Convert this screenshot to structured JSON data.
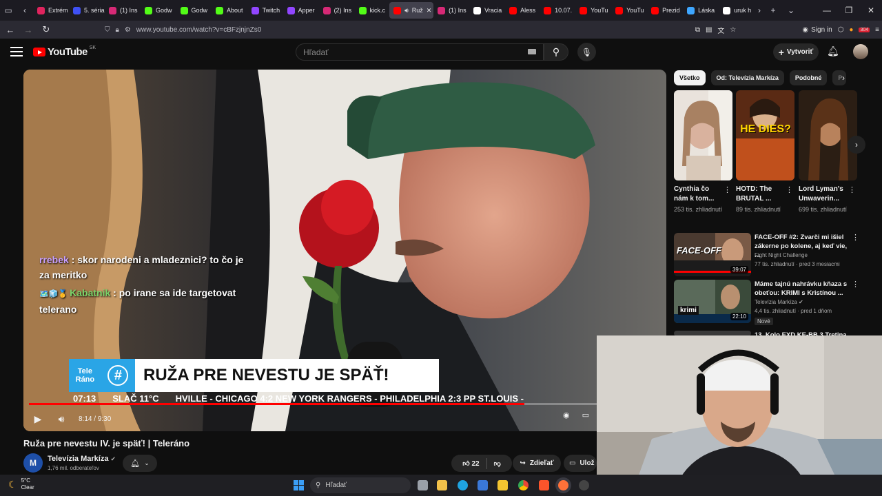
{
  "browser": {
    "tabs": [
      {
        "label": "Extrém",
        "color": "#e0245e"
      },
      {
        "label": "5. séria",
        "color": "#3f51f5"
      },
      {
        "label": "(1) Ins",
        "color": "#d62976"
      },
      {
        "label": "Godw",
        "color": "#53fc18"
      },
      {
        "label": "Godw",
        "color": "#53fc18"
      },
      {
        "label": "About",
        "color": "#53fc18"
      },
      {
        "label": "Twitch",
        "color": "#9146ff"
      },
      {
        "label": "Apper",
        "color": "#9146ff"
      },
      {
        "label": "(2) Ins",
        "color": "#d62976"
      },
      {
        "label": "kick.c",
        "color": "#53fc18"
      },
      {
        "label": "Ruž",
        "color": "#ff0000",
        "active": true
      },
      {
        "label": "(1) Ins",
        "color": "#d62976"
      },
      {
        "label": "Vracia",
        "color": "#ffffff"
      },
      {
        "label": "Aless",
        "color": "#ff0000"
      },
      {
        "label": "10.07.",
        "color": "#ff0000"
      },
      {
        "label": "YouTu",
        "color": "#ff0000"
      },
      {
        "label": "YouTu",
        "color": "#ff0000"
      },
      {
        "label": "Prezid",
        "color": "#ff0000"
      },
      {
        "label": "Láska",
        "color": "#3ea6ff"
      },
      {
        "label": "uruk h",
        "color": "#ffffff"
      }
    ],
    "url": "www.youtube.com/watch?v=cBFzjnjnZs0",
    "signin_label": "Sign in",
    "badge_count": "304"
  },
  "youtube": {
    "logo_text": "YouTube",
    "region": "SK",
    "search_placeholder": "Hľadať",
    "create_label": "Vytvoriť"
  },
  "video": {
    "chat": [
      {
        "user": "rrebek",
        "message": " : skor narodeni a mladeznici? to čo je za meritko"
      },
      {
        "user": "Kabatnik",
        "message": " : po irane sa ide targetovat telerano"
      }
    ],
    "overlay_brand_line1": "Tele",
    "overlay_brand_line2": "Ráno",
    "overlay_hashtag": "#",
    "overlay_headline": "RUŽA PRE NEVESTU JE SPÄŤ!",
    "ticker_time": "07:13",
    "ticker_weather": "SLAČ 11°C",
    "ticker_text": "HVILLE - CHICAGO 4:2 NEW YORK RANGERS - PHILADELPHIA 2:3 PP ST.LOUIS -",
    "progress": 0.872,
    "current_time": "8:14",
    "duration": "9:30",
    "time_separator": "/",
    "title": "Ruža pre nevestu IV. je späť! | Teleráno",
    "channel_name": "Televízia Markíza",
    "subscribers": "1,76 mil. odberateľov",
    "channel_initial": "M",
    "likes": "22",
    "share_label": "Zdieľať",
    "save_label": "Ulož"
  },
  "sidebar": {
    "chips": [
      "Všetko",
      "Od: Televízia Markíza",
      "Podobné",
      "P"
    ],
    "shorts": [
      {
        "title": "Cynthia čo nám k tom...",
        "views": "253 tis. zhliadnutí"
      },
      {
        "title": "HOTD: The BRUTAL ...",
        "views": "89 tis. zhliadnutí",
        "overlay": "HE DIES?"
      },
      {
        "title": "Lord Lyman's Unwaverin...",
        "views": "699 tis. zhliadnutí"
      }
    ],
    "videos": [
      {
        "title": "FACE-OFF #2: Zvarči mi išiel zákerne po kolene, aj keď vie, ...",
        "channel": "Fight Night Challenge",
        "meta": "77 tis. zhliadnutí · pred 3 mesiacmi",
        "duration": "39:07",
        "thumb_text": "FACE-OFF"
      },
      {
        "title": "Máme tajnú nahrávku kňaza s obeťou: KRIMI s Kristínou ...",
        "channel": "Televízia Markíza",
        "meta": "4,4 tis. zhliadnutí · pred 1 dňom",
        "duration": "22:10",
        "badge": "Nové",
        "thumb_text": "krimi"
      },
      {
        "title": "13. Kolo EXD KE-BB 3 Tretina",
        "channel": "",
        "meta": "",
        "duration": "",
        "thumb_text": ""
      }
    ]
  },
  "taskbar": {
    "temp": "5°C",
    "weather": "Clear",
    "search_placeholder": "Hľadať"
  }
}
